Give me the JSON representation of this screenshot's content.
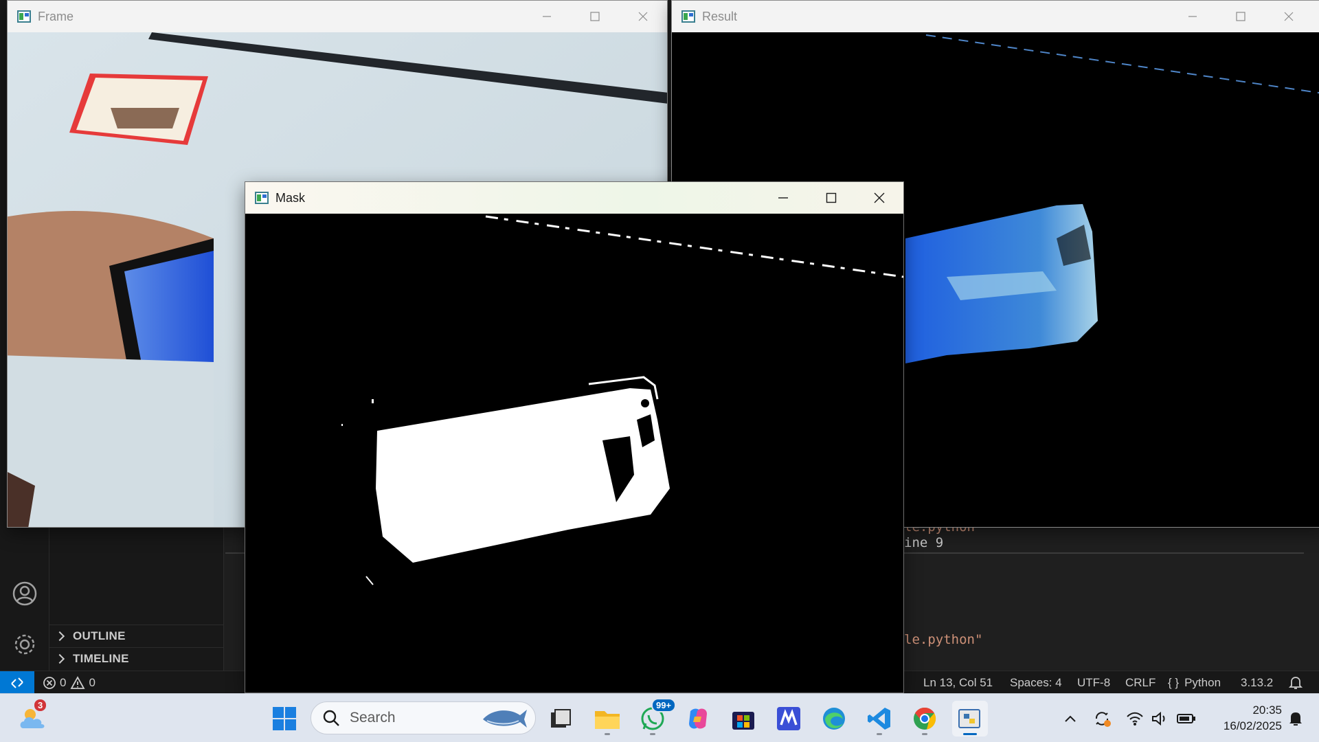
{
  "vscode": {
    "sidebar_sections": {
      "outline": "OUTLINE",
      "timeline": "TIMELINE"
    },
    "terminal_lines": [
      "le.python",
      "ine 9",
      "le.python\""
    ],
    "status": {
      "errors": "0",
      "warnings": "0",
      "position": "Ln 13, Col 51",
      "spaces": "Spaces: 4",
      "encoding": "UTF-8",
      "eol": "CRLF",
      "language_braces": "{ }",
      "language": "Python",
      "python_version": "3.13.2"
    }
  },
  "windows": {
    "frame": {
      "title": "Frame"
    },
    "result": {
      "title": "Result"
    },
    "mask": {
      "title": "Mask"
    }
  },
  "taskbar": {
    "weather_badge": "3",
    "search_placeholder": "Search",
    "whatsapp_badge": "99+",
    "time": "20:35",
    "date": "16/02/2025",
    "apps": [
      "start-icon",
      "search-icon",
      "task-view-icon",
      "file-explorer-icon",
      "whatsapp-icon",
      "copilot-icon",
      "microsoft-store-icon",
      "markdown-editor-icon",
      "edge-icon",
      "vscode-icon",
      "chrome-icon",
      "python-icon"
    ]
  },
  "colors": {
    "vscode_bg": "#1f1f1f",
    "status_remote": "#0078d4",
    "taskbar_bg": "#dfe5ef",
    "mask_bg": "#000000",
    "mask_fg": "#ffffff"
  }
}
